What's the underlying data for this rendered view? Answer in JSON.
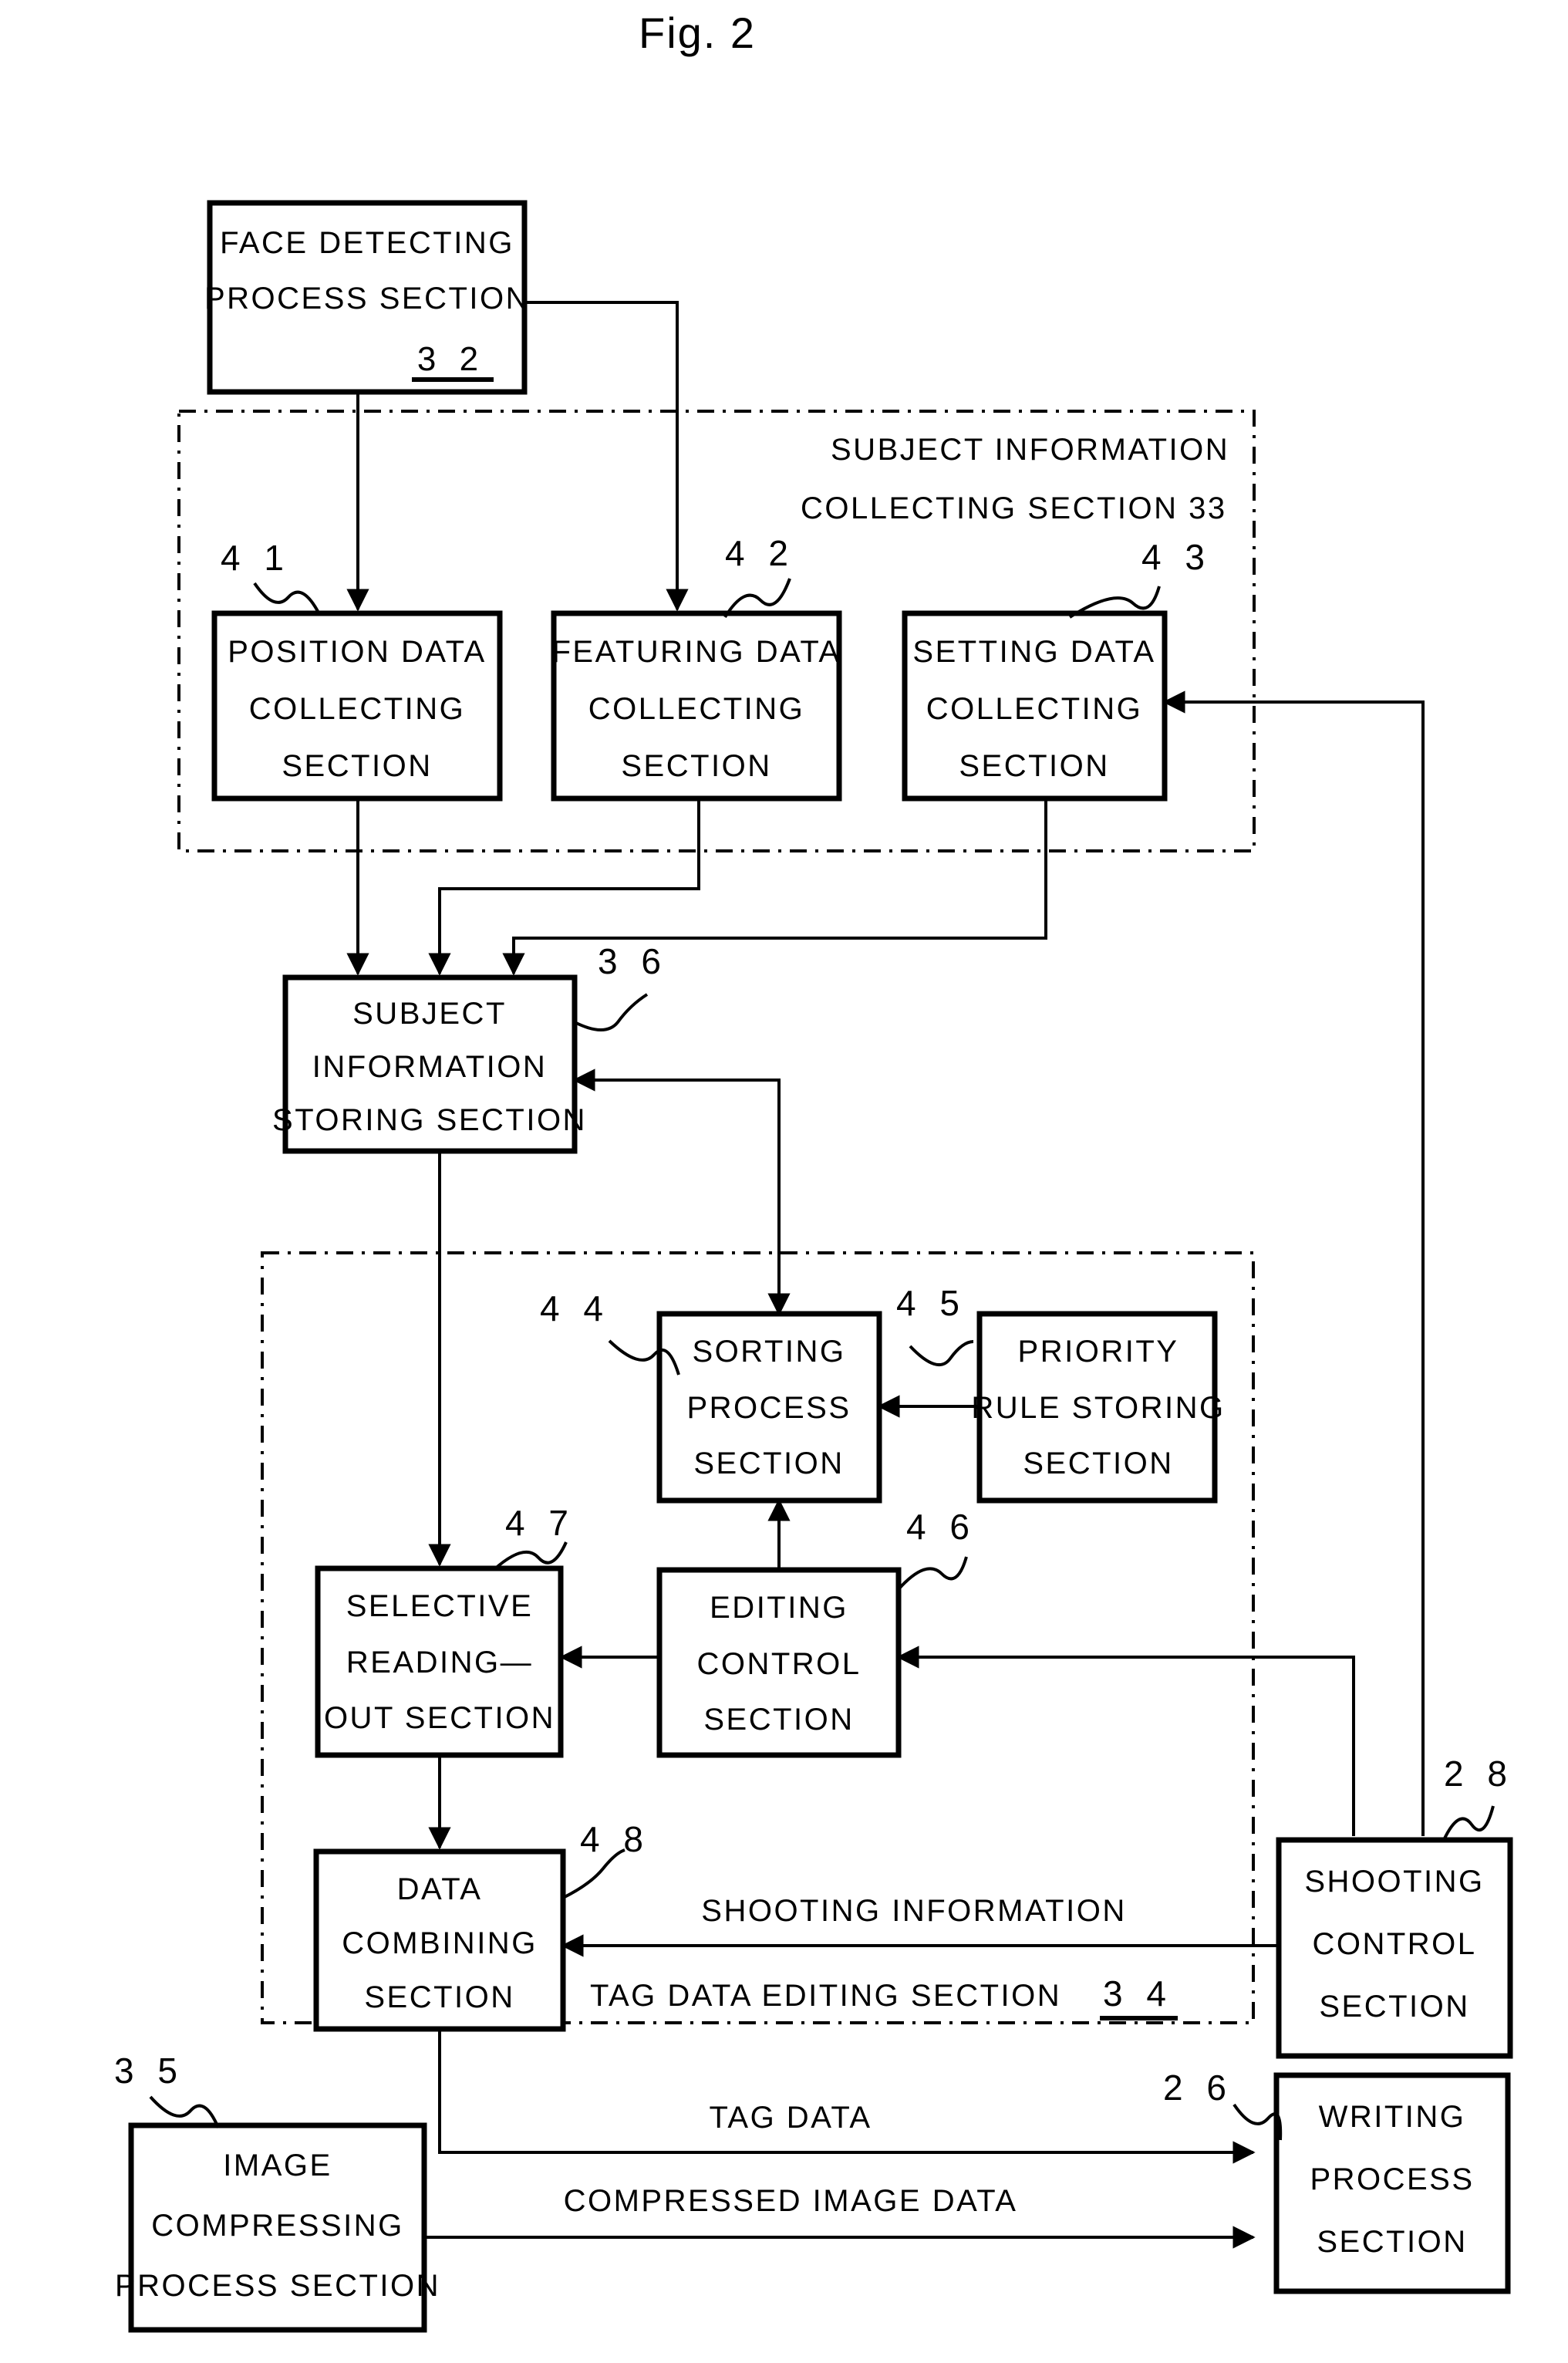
{
  "figure": {
    "title": "Fig. 2"
  },
  "boxes": {
    "face_detecting": {
      "lines": [
        "FACE DETECTING",
        "PROCESS SECTION"
      ],
      "ref": "3 2"
    },
    "position_data": {
      "lines": [
        "POSITION DATA",
        "COLLECTING",
        "SECTION"
      ],
      "ref": "4 1"
    },
    "featuring_data": {
      "lines": [
        "FEATURING DATA",
        "COLLECTING",
        "SECTION"
      ],
      "ref": "4 2"
    },
    "setting_data": {
      "lines": [
        "SETTING DATA",
        "COLLECTING",
        "SECTION"
      ],
      "ref": "4 3"
    },
    "subject_info_storing": {
      "lines": [
        "SUBJECT",
        "INFORMATION",
        "STORING SECTION"
      ],
      "ref": "3 6"
    },
    "sorting_process": {
      "lines": [
        "SORTING",
        "PROCESS",
        "SECTION"
      ],
      "ref": "4 4"
    },
    "priority_rule_storing": {
      "lines": [
        "PRIORITY",
        "RULE STORING",
        "SECTION"
      ],
      "ref": "4 5"
    },
    "selective_reading_out": {
      "lines": [
        "SELECTIVE",
        "READING—",
        "OUT SECTION"
      ],
      "ref": "4 7"
    },
    "editing_control": {
      "lines": [
        "EDITING",
        "CONTROL",
        "SECTION"
      ],
      "ref": "4 6"
    },
    "data_combining": {
      "lines": [
        "DATA",
        "COMBINING",
        "SECTION"
      ],
      "ref": "4 8"
    },
    "shooting_control": {
      "lines": [
        "SHOOTING",
        "CONTROL",
        "SECTION"
      ],
      "ref": "2 8"
    },
    "image_compressing": {
      "lines": [
        "IMAGE",
        "COMPRESSING",
        "PROCESS SECTION"
      ],
      "ref": "3 5"
    },
    "writing_process": {
      "lines": [
        "WRITING",
        "PROCESS",
        "SECTION"
      ],
      "ref": "2 6"
    }
  },
  "regions": {
    "subject_information_collecting": {
      "lines": [
        "SUBJECT INFORMATION",
        "COLLECTING SECTION   33"
      ],
      "ref": "33"
    },
    "tag_data_editing": {
      "label": "TAG DATA EDITING SECTION",
      "ref": "3 4"
    }
  },
  "edge_labels": {
    "shooting_information": "SHOOTING INFORMATION",
    "tag_data": "TAG DATA",
    "compressed_image_data": "COMPRESSED IMAGE DATA"
  },
  "colors": {
    "ink": "#000000",
    "paper": "#ffffff"
  }
}
